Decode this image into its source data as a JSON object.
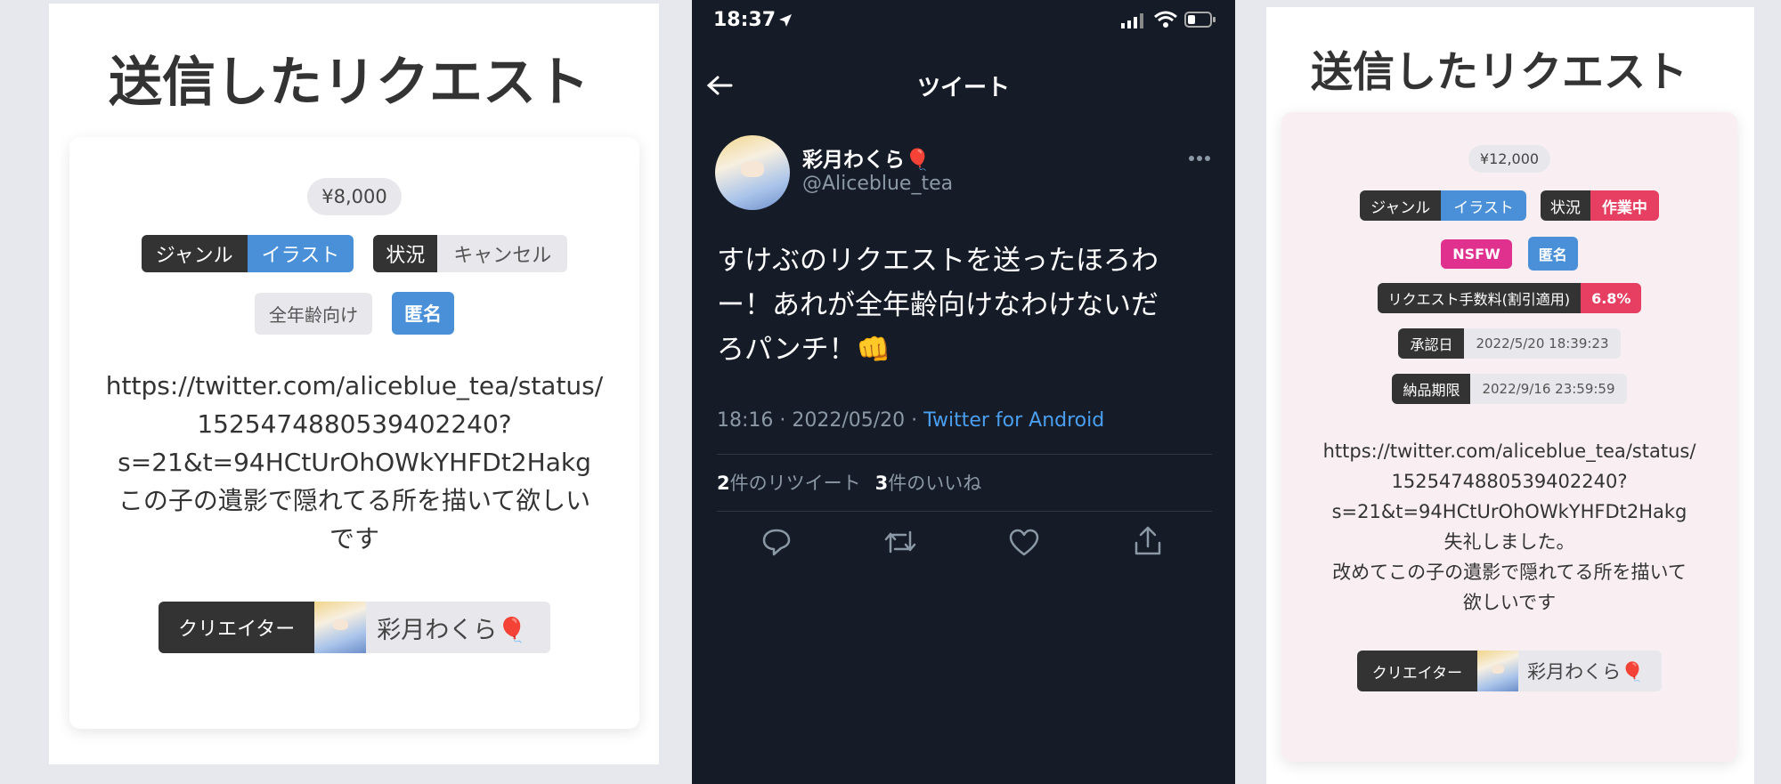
{
  "left": {
    "title": "送信したリクエスト",
    "price": "¥8,000",
    "genre_label": "ジャンル",
    "genre_value": "イラスト",
    "status_label": "状況",
    "status_value": "キャンセル",
    "tag_age": "全年齢向け",
    "tag_anon": "匿名",
    "body_lines": [
      "https://twitter.com/aliceblue_tea/status/",
      "1525474880539402240?",
      "s=21&t=94HCtUrOhOWkYHFDt2Hakg",
      "この子の遺影で隠れてる所を描いて欲しい",
      "です"
    ],
    "creator_label": "クリエイター",
    "creator_name": "彩月わくら🎈"
  },
  "tweet": {
    "time": "18:37",
    "header_title": "ツイート",
    "display_name": "彩月わくら🎈",
    "handle": "@Aliceblue_tea",
    "text_lines": [
      "すけぶのリクエストを送ったほろわ",
      "ー！あれが全年齢向けなわけないだ",
      "ろパンチ！👊"
    ],
    "meta_time": "18:16 · 2022/05/20 · ",
    "meta_source": "Twitter for Android",
    "retweet_count": "2",
    "retweet_label": "件のリツイート",
    "like_count": "3",
    "like_label": "件のいいね",
    "link_color": "#4a9ff0"
  },
  "right": {
    "title": "送信したリクエスト",
    "price": "¥12,000",
    "genre_label": "ジャンル",
    "genre_value": "イラスト",
    "status_label": "状況",
    "status_value": "作業中",
    "tag_nsfw": "NSFW",
    "tag_anon": "匿名",
    "fee_label": "リクエスト手数料(割引適用)",
    "fee_value": "6.8%",
    "approved_label": "承認日",
    "approved_value": "2022/5/20 18:39:23",
    "deadline_label": "納品期限",
    "deadline_value": "2022/9/16 23:59:59",
    "body_lines": [
      "https://twitter.com/aliceblue_tea/status/",
      "1525474880539402240?",
      "s=21&t=94HCtUrOhOWkYHFDt2Hakg",
      "失礼しました。",
      "改めてこの子の遺影で隠れてる所を描いて",
      "欲しいです"
    ],
    "creator_label": "クリエイター",
    "creator_name": "彩月わくら🎈"
  },
  "colors": {
    "tag_blue": "#4a90d9",
    "tag_dark": "#333333",
    "status_pink": "#e63f62",
    "nsfw_magenta": "#e0318f",
    "tweet_bg": "#151b27"
  }
}
